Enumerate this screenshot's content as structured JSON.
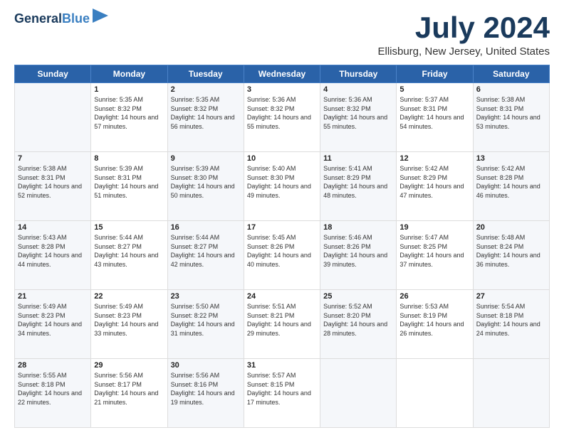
{
  "logo": {
    "line1": "General",
    "line2": "Blue"
  },
  "title": "July 2024",
  "subtitle": "Ellisburg, New Jersey, United States",
  "weekdays": [
    "Sunday",
    "Monday",
    "Tuesday",
    "Wednesday",
    "Thursday",
    "Friday",
    "Saturday"
  ],
  "weeks": [
    [
      {
        "day": "",
        "sunrise": "",
        "sunset": "",
        "daylight": ""
      },
      {
        "day": "1",
        "sunrise": "Sunrise: 5:35 AM",
        "sunset": "Sunset: 8:32 PM",
        "daylight": "Daylight: 14 hours and 57 minutes."
      },
      {
        "day": "2",
        "sunrise": "Sunrise: 5:35 AM",
        "sunset": "Sunset: 8:32 PM",
        "daylight": "Daylight: 14 hours and 56 minutes."
      },
      {
        "day": "3",
        "sunrise": "Sunrise: 5:36 AM",
        "sunset": "Sunset: 8:32 PM",
        "daylight": "Daylight: 14 hours and 55 minutes."
      },
      {
        "day": "4",
        "sunrise": "Sunrise: 5:36 AM",
        "sunset": "Sunset: 8:32 PM",
        "daylight": "Daylight: 14 hours and 55 minutes."
      },
      {
        "day": "5",
        "sunrise": "Sunrise: 5:37 AM",
        "sunset": "Sunset: 8:31 PM",
        "daylight": "Daylight: 14 hours and 54 minutes."
      },
      {
        "day": "6",
        "sunrise": "Sunrise: 5:38 AM",
        "sunset": "Sunset: 8:31 PM",
        "daylight": "Daylight: 14 hours and 53 minutes."
      }
    ],
    [
      {
        "day": "7",
        "sunrise": "Sunrise: 5:38 AM",
        "sunset": "Sunset: 8:31 PM",
        "daylight": "Daylight: 14 hours and 52 minutes."
      },
      {
        "day": "8",
        "sunrise": "Sunrise: 5:39 AM",
        "sunset": "Sunset: 8:31 PM",
        "daylight": "Daylight: 14 hours and 51 minutes."
      },
      {
        "day": "9",
        "sunrise": "Sunrise: 5:39 AM",
        "sunset": "Sunset: 8:30 PM",
        "daylight": "Daylight: 14 hours and 50 minutes."
      },
      {
        "day": "10",
        "sunrise": "Sunrise: 5:40 AM",
        "sunset": "Sunset: 8:30 PM",
        "daylight": "Daylight: 14 hours and 49 minutes."
      },
      {
        "day": "11",
        "sunrise": "Sunrise: 5:41 AM",
        "sunset": "Sunset: 8:29 PM",
        "daylight": "Daylight: 14 hours and 48 minutes."
      },
      {
        "day": "12",
        "sunrise": "Sunrise: 5:42 AM",
        "sunset": "Sunset: 8:29 PM",
        "daylight": "Daylight: 14 hours and 47 minutes."
      },
      {
        "day": "13",
        "sunrise": "Sunrise: 5:42 AM",
        "sunset": "Sunset: 8:28 PM",
        "daylight": "Daylight: 14 hours and 46 minutes."
      }
    ],
    [
      {
        "day": "14",
        "sunrise": "Sunrise: 5:43 AM",
        "sunset": "Sunset: 8:28 PM",
        "daylight": "Daylight: 14 hours and 44 minutes."
      },
      {
        "day": "15",
        "sunrise": "Sunrise: 5:44 AM",
        "sunset": "Sunset: 8:27 PM",
        "daylight": "Daylight: 14 hours and 43 minutes."
      },
      {
        "day": "16",
        "sunrise": "Sunrise: 5:44 AM",
        "sunset": "Sunset: 8:27 PM",
        "daylight": "Daylight: 14 hours and 42 minutes."
      },
      {
        "day": "17",
        "sunrise": "Sunrise: 5:45 AM",
        "sunset": "Sunset: 8:26 PM",
        "daylight": "Daylight: 14 hours and 40 minutes."
      },
      {
        "day": "18",
        "sunrise": "Sunrise: 5:46 AM",
        "sunset": "Sunset: 8:26 PM",
        "daylight": "Daylight: 14 hours and 39 minutes."
      },
      {
        "day": "19",
        "sunrise": "Sunrise: 5:47 AM",
        "sunset": "Sunset: 8:25 PM",
        "daylight": "Daylight: 14 hours and 37 minutes."
      },
      {
        "day": "20",
        "sunrise": "Sunrise: 5:48 AM",
        "sunset": "Sunset: 8:24 PM",
        "daylight": "Daylight: 14 hours and 36 minutes."
      }
    ],
    [
      {
        "day": "21",
        "sunrise": "Sunrise: 5:49 AM",
        "sunset": "Sunset: 8:23 PM",
        "daylight": "Daylight: 14 hours and 34 minutes."
      },
      {
        "day": "22",
        "sunrise": "Sunrise: 5:49 AM",
        "sunset": "Sunset: 8:23 PM",
        "daylight": "Daylight: 14 hours and 33 minutes."
      },
      {
        "day": "23",
        "sunrise": "Sunrise: 5:50 AM",
        "sunset": "Sunset: 8:22 PM",
        "daylight": "Daylight: 14 hours and 31 minutes."
      },
      {
        "day": "24",
        "sunrise": "Sunrise: 5:51 AM",
        "sunset": "Sunset: 8:21 PM",
        "daylight": "Daylight: 14 hours and 29 minutes."
      },
      {
        "day": "25",
        "sunrise": "Sunrise: 5:52 AM",
        "sunset": "Sunset: 8:20 PM",
        "daylight": "Daylight: 14 hours and 28 minutes."
      },
      {
        "day": "26",
        "sunrise": "Sunrise: 5:53 AM",
        "sunset": "Sunset: 8:19 PM",
        "daylight": "Daylight: 14 hours and 26 minutes."
      },
      {
        "day": "27",
        "sunrise": "Sunrise: 5:54 AM",
        "sunset": "Sunset: 8:18 PM",
        "daylight": "Daylight: 14 hours and 24 minutes."
      }
    ],
    [
      {
        "day": "28",
        "sunrise": "Sunrise: 5:55 AM",
        "sunset": "Sunset: 8:18 PM",
        "daylight": "Daylight: 14 hours and 22 minutes."
      },
      {
        "day": "29",
        "sunrise": "Sunrise: 5:56 AM",
        "sunset": "Sunset: 8:17 PM",
        "daylight": "Daylight: 14 hours and 21 minutes."
      },
      {
        "day": "30",
        "sunrise": "Sunrise: 5:56 AM",
        "sunset": "Sunset: 8:16 PM",
        "daylight": "Daylight: 14 hours and 19 minutes."
      },
      {
        "day": "31",
        "sunrise": "Sunrise: 5:57 AM",
        "sunset": "Sunset: 8:15 PM",
        "daylight": "Daylight: 14 hours and 17 minutes."
      },
      {
        "day": "",
        "sunrise": "",
        "sunset": "",
        "daylight": ""
      },
      {
        "day": "",
        "sunrise": "",
        "sunset": "",
        "daylight": ""
      },
      {
        "day": "",
        "sunrise": "",
        "sunset": "",
        "daylight": ""
      }
    ]
  ]
}
